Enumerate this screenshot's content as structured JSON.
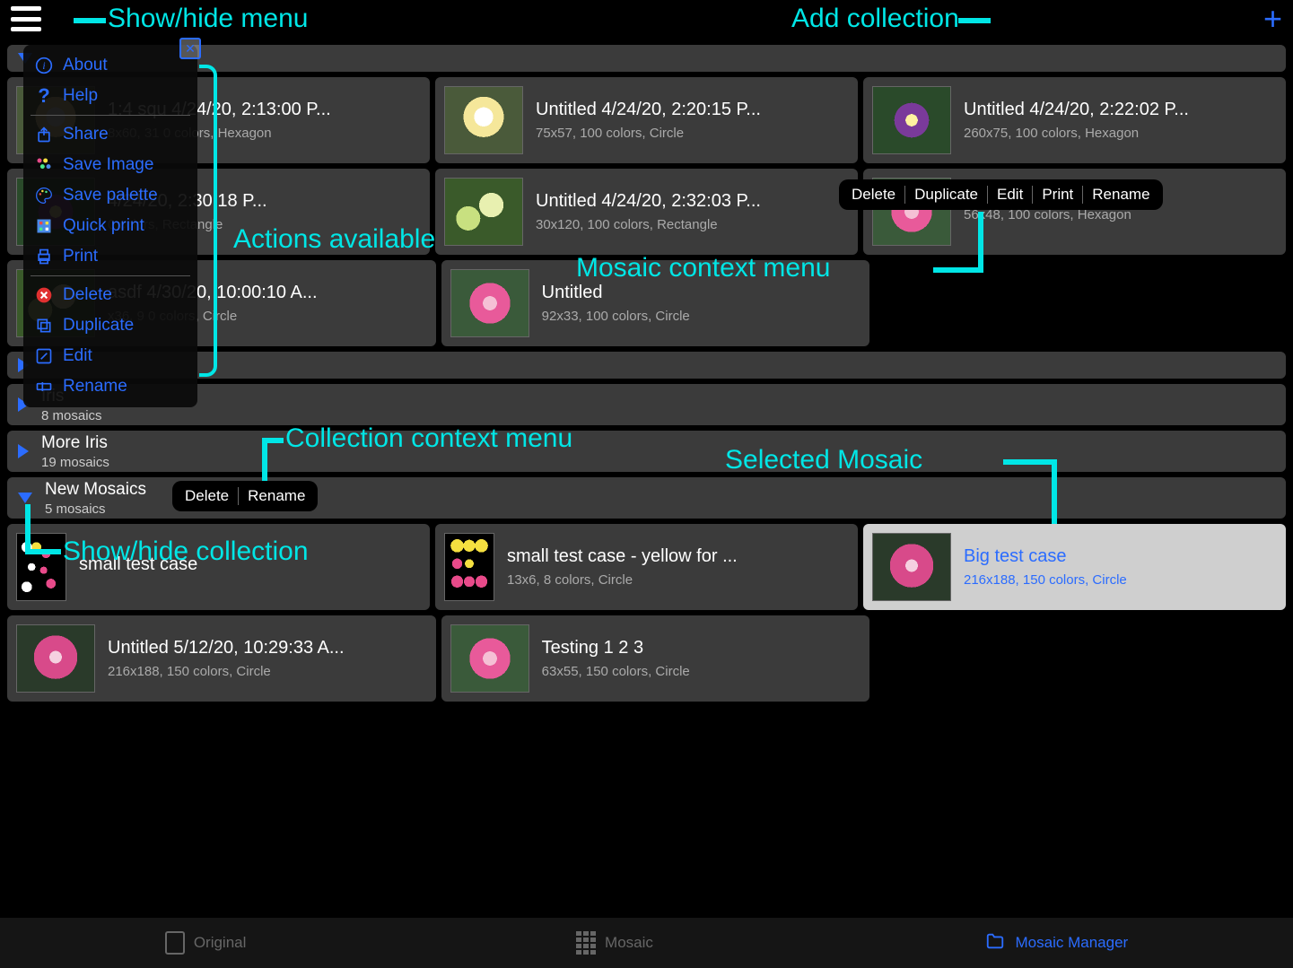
{
  "annotations": {
    "show_hide_menu": "Show/hide menu",
    "add_collection": "Add collection",
    "actions_available": "Actions available",
    "mosaic_context_menu": "Mosaic context menu",
    "collection_context_menu": "Collection context menu",
    "selected_mosaic": "Selected Mosaic",
    "show_hide_collection": "Show/hide collection"
  },
  "menu": {
    "items": [
      {
        "label": "About",
        "icon": "info"
      },
      {
        "label": "Help",
        "icon": "question"
      },
      {
        "label": "Share",
        "icon": "share"
      },
      {
        "label": "Save Image",
        "icon": "save-image"
      },
      {
        "label": "Save palette",
        "icon": "palette"
      },
      {
        "label": "Quick print",
        "icon": "quick-print"
      },
      {
        "label": "Print",
        "icon": "print"
      },
      {
        "label": "Delete",
        "icon": "delete"
      },
      {
        "label": "Duplicate",
        "icon": "duplicate"
      },
      {
        "label": "Edit",
        "icon": "edit"
      },
      {
        "label": "Rename",
        "icon": "rename"
      }
    ]
  },
  "mosaic_context": {
    "items": [
      "Delete",
      "Duplicate",
      "Edit",
      "Print",
      "Rename"
    ]
  },
  "collection_context": {
    "items": [
      "Delete",
      "Rename"
    ]
  },
  "collections_collapsed": [
    {
      "name": "Iris",
      "count": "8 mosaics"
    },
    {
      "name": "More Iris",
      "count": "19 mosaics"
    },
    {
      "name": "New Mosaics",
      "count": "5 mosaics"
    }
  ],
  "rows": {
    "r1": [
      {
        "title": "1:4 squ 4/24/20, 2:13:00 P...",
        "sub": "8x60, 31 0 colors, Hexagon"
      },
      {
        "title": "Untitled 4/24/20, 2:20:15 P...",
        "sub": "75x57, 100 colors, Circle"
      },
      {
        "title": "Untitled 4/24/20, 2:22:02 P...",
        "sub": "260x75, 100 colors, Hexagon"
      }
    ],
    "r2": [
      {
        "title": "4/24/20, 2:30:18 P...",
        "sub": "0 colors, Rectangle"
      },
      {
        "title": "Untitled 4/24/20, 2:32:03 P...",
        "sub": "30x120, 100 colors, Rectangle"
      },
      {
        "title": "",
        "sub": "56x48, 100 colors, Hexagon"
      }
    ],
    "r3": [
      {
        "title": "asdf 4/30/20, 10:00:10 A...",
        "sub": "x36, 9 0 colors, Circle"
      },
      {
        "title": "Untitled",
        "sub": "92x33, 100 colors, Circle"
      }
    ],
    "r4": [
      {
        "title": "small test case",
        "sub": ""
      },
      {
        "title": "small test case - yellow for ...",
        "sub": "13x6, 8 colors, Circle"
      },
      {
        "title": "Big test case",
        "sub": "216x188, 150 colors, Circle"
      }
    ],
    "r5": [
      {
        "title": "Untitled 5/12/20, 10:29:33 A...",
        "sub": "216x188, 150 colors, Circle"
      },
      {
        "title": "Testing 1 2 3",
        "sub": "63x55, 150 colors, Circle"
      }
    ]
  },
  "bottom_tabs": {
    "original": "Original",
    "mosaic": "Mosaic",
    "manager": "Mosaic Manager"
  }
}
